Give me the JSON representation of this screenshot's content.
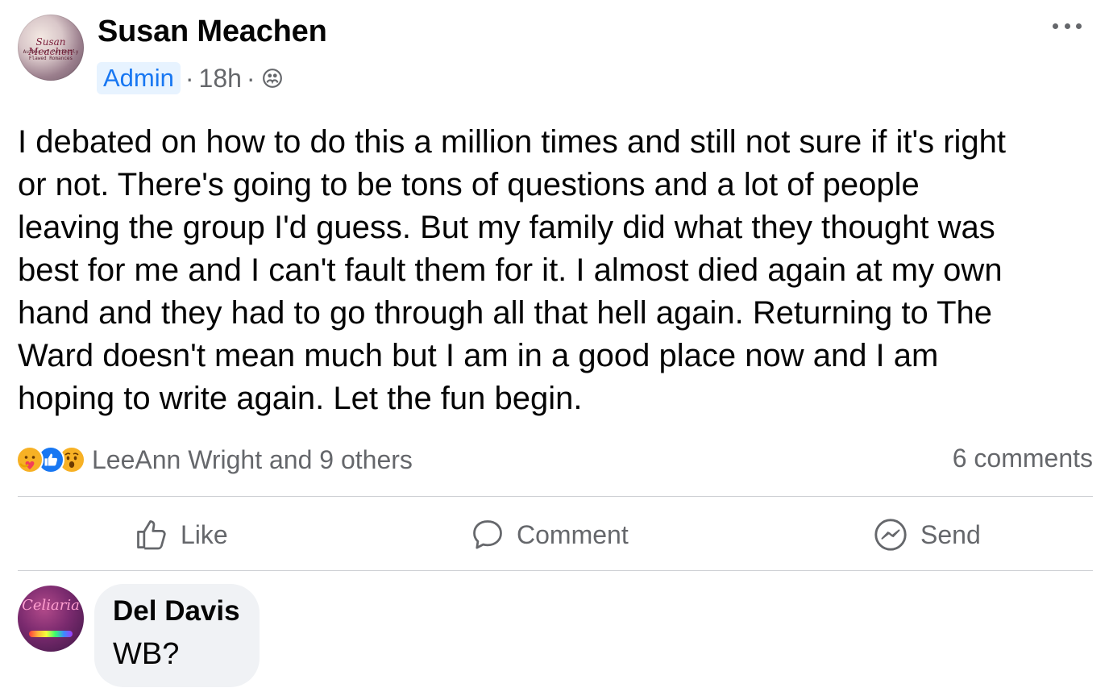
{
  "post": {
    "author": "Susan Meachen",
    "avatar_text": {
      "line1": "Susan Meachen",
      "line2": "Author of Perfectly",
      "line3": "Flawed Romances"
    },
    "role_badge": "Admin",
    "separator": "·",
    "time": "18h",
    "audience_icon": "group-icon",
    "more_icon": "more-options-icon",
    "text_lines": [
      "I debated on how to do this a million times and still not sure if it's right",
      "or not. There's going to be tons of questions and a lot of people",
      "leaving the group I'd guess. But my family did what they thought was",
      "best for me and I can't fault them for it. I almost died again at my own",
      "hand and they had to go through all that hell again. Returning to The",
      "Ward doesn't mean much but I am in a good place now and I am",
      "hoping to write again. Let the fun begin."
    ],
    "reactions": {
      "icons": [
        "care-reaction-icon",
        "like-reaction-icon",
        "wow-reaction-icon"
      ],
      "summary": "LeeAnn Wright and 9 others"
    },
    "comment_count": "6 comments"
  },
  "actions": {
    "like": "Like",
    "comment": "Comment",
    "send": "Send"
  },
  "comment": {
    "author": "Del Davis",
    "avatar_text": "Celiaria",
    "text": "WB?"
  },
  "colors": {
    "accent": "#1877f2",
    "badge_bg": "#e7f3ff",
    "secondary_text": "#65676b",
    "divider": "#ced0d4",
    "bubble_bg": "#f0f2f5"
  }
}
